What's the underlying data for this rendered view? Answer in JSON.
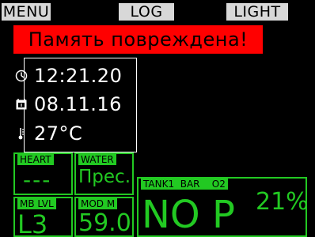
{
  "softkeys": {
    "left": "MENU",
    "center": "LOG",
    "right": "LIGHT"
  },
  "alarm": {
    "text": "Память повреждена!",
    "color": "#ff0000"
  },
  "info": {
    "time": "12:21.20",
    "date": "08.11.16",
    "temperature": "27°C"
  },
  "fields": {
    "heart": {
      "label": "HEART",
      "value": "---"
    },
    "water": {
      "label": "WATER",
      "value": "Прес."
    },
    "mb_lvl": {
      "label": "MB LVL",
      "value": "L3"
    },
    "mod": {
      "label": "MOD  M",
      "value": "59.0"
    },
    "tank": {
      "label": "TANK1  BAR    O2",
      "value": "NO P",
      "o2": "21%"
    }
  },
  "colors": {
    "accent": "#22c922",
    "softkey_bg": "#d8d8d8",
    "background": "#000000"
  },
  "icons": [
    "clock-icon",
    "calendar-icon",
    "thermometer-icon"
  ]
}
